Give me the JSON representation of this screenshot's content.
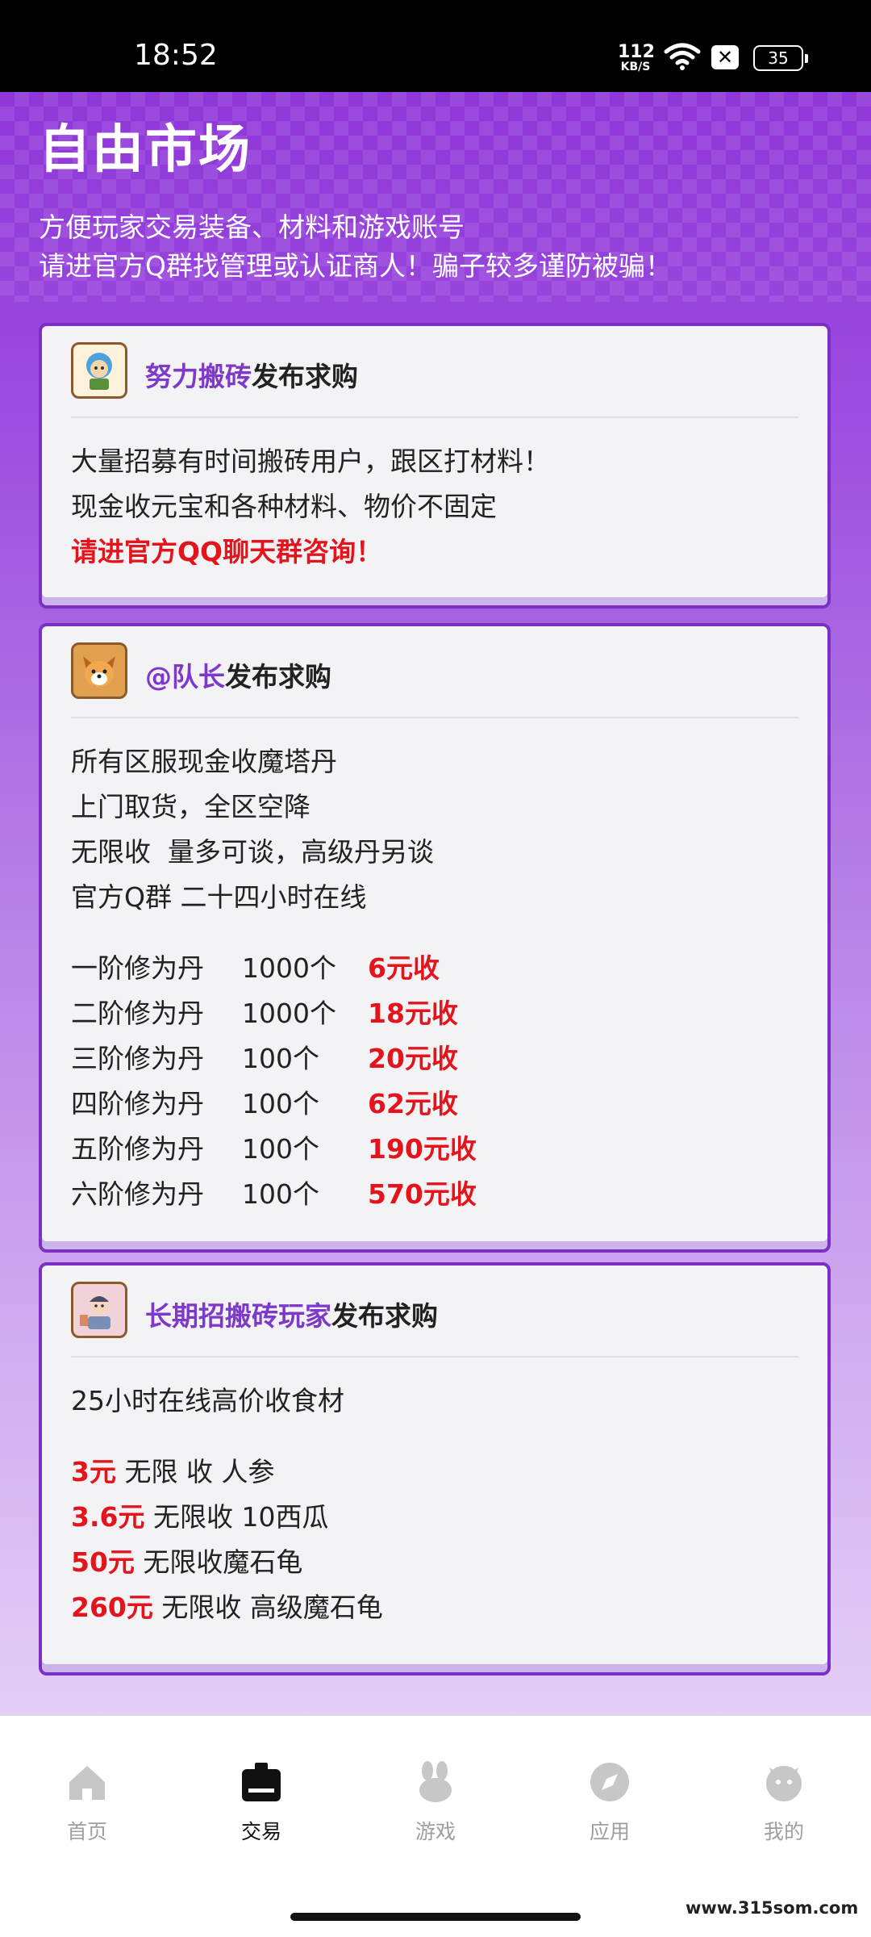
{
  "status_bar": {
    "time": "18:52",
    "net_speed": "112",
    "net_unit": "KB/S",
    "battery": "35"
  },
  "header": {
    "title": "自由市场",
    "subtitle_lines": [
      "方便玩家交易装备、材料和游戏账号",
      "请进官方Q群找管理或认证商人！骗子较多谨防被骗！"
    ]
  },
  "posts": [
    {
      "author": "努力搬砖",
      "action": "发布求购",
      "lines": [
        "大量招募有时间搬砖用户，跟区打材料！",
        "现金收元宝和各种材料、物价不固定"
      ],
      "highlight": "请进官方QQ聊天群咨询！"
    },
    {
      "author": "@队长",
      "action": "发布求购",
      "lines": [
        "所有区服现金收魔塔丹",
        "上门取货，全区空降",
        "无限收  量多可谈，高级丹另谈",
        "官方Q群 二十四小时在线"
      ],
      "price_rows": [
        {
          "item": "一阶修为丹",
          "qty": "1000个",
          "price": "6元收"
        },
        {
          "item": "二阶修为丹",
          "qty": "1000个",
          "price": "18元收"
        },
        {
          "item": "三阶修为丹",
          "qty": "100个",
          "price": "20元收"
        },
        {
          "item": "四阶修为丹",
          "qty": "100个",
          "price": "62元收"
        },
        {
          "item": "五阶修为丹",
          "qty": "100个",
          "price": "190元收"
        },
        {
          "item": "六阶修为丹",
          "qty": "100个",
          "price": "570元收"
        }
      ]
    },
    {
      "author": "长期招搬砖玩家",
      "action": "发布求购",
      "lines": [
        "25小时在线高价收食材"
      ],
      "offers": [
        {
          "price": "3元",
          "text": " 无限 收 人参"
        },
        {
          "price": "3.6元",
          "text": " 无限收 10西瓜"
        },
        {
          "price": "50元",
          "text": " 无限收魔石龟"
        },
        {
          "price": "260元",
          "text": " 无限收 高级魔石龟"
        }
      ]
    }
  ],
  "tabs": [
    {
      "label": "首页",
      "icon": "home-icon",
      "active": false
    },
    {
      "label": "交易",
      "icon": "trade-icon",
      "active": true
    },
    {
      "label": "游戏",
      "icon": "game-icon",
      "active": false
    },
    {
      "label": "应用",
      "icon": "compass-icon",
      "active": false
    },
    {
      "label": "我的",
      "icon": "profile-icon",
      "active": false
    }
  ],
  "watermark": "www.315som.com",
  "colors": {
    "accent": "#7c2fc4",
    "name": "#7d3ac9",
    "price_red": "#e3141c"
  }
}
